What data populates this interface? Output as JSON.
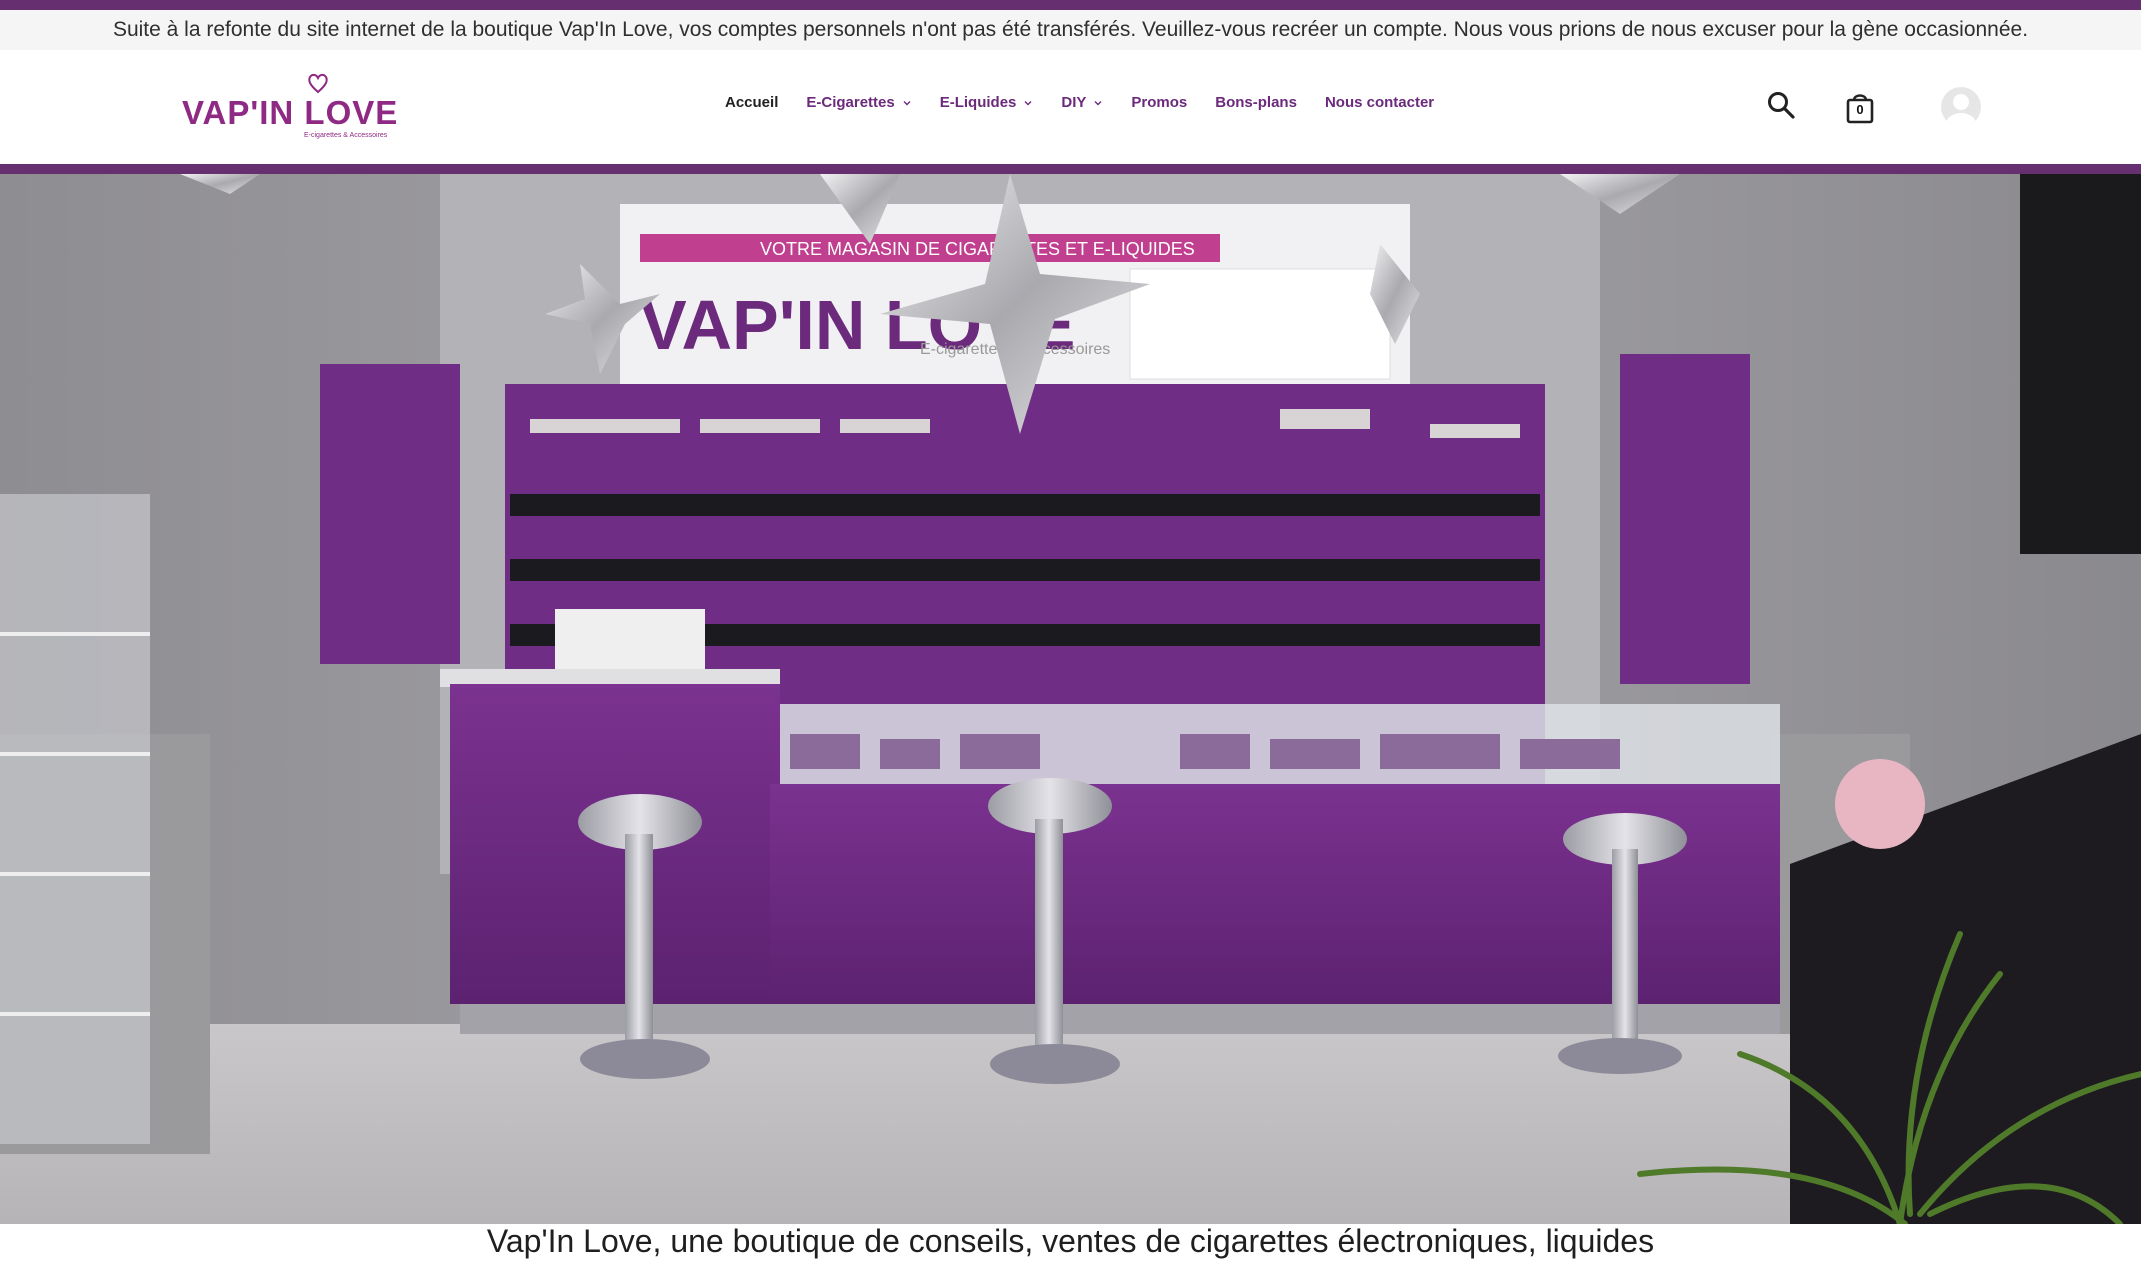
{
  "notice": {
    "text": "Suite à la refonte du site internet de la boutique Vap'In Love, vos comptes personnels n'ont pas été transférés. Veuillez-vous recréer un compte. Nous vous prions de nous excuser pour la gène occasionnée."
  },
  "logo": {
    "name": "VAP'IN LOVE",
    "tagline": "E-cigarettes & Accessoires"
  },
  "nav": {
    "items": [
      {
        "label": "Accueil",
        "active": true
      },
      {
        "label": "E-Cigarettes",
        "dropdown": true
      },
      {
        "label": "E-Liquides",
        "dropdown": true
      },
      {
        "label": "DIY",
        "dropdown": true
      },
      {
        "label": "Promos"
      },
      {
        "label": "Bons-plans"
      },
      {
        "label": "Nous contacter"
      }
    ]
  },
  "header": {
    "search_icon": "search-icon",
    "cart_icon": "shopping-bag-icon",
    "cart_count": "0",
    "account_icon": "user-avatar-icon"
  },
  "hero": {
    "sign_title": "VAP'IN LOVE",
    "sign_subtitle": "E-cigarettes & Accessoires",
    "sign_banner": "VOTRE MAGASIN DE CIGARETTES ET E-LIQUIDES"
  },
  "intro": {
    "text": "Vap'In Love, une boutique de conseils, ventes de cigarettes électroniques, liquides"
  },
  "colors": {
    "brand_purple": "#652f70",
    "nav_purple": "#6b2a7c",
    "logo_purple": "#8e2a83",
    "counter_purple": "#6e2b82"
  }
}
